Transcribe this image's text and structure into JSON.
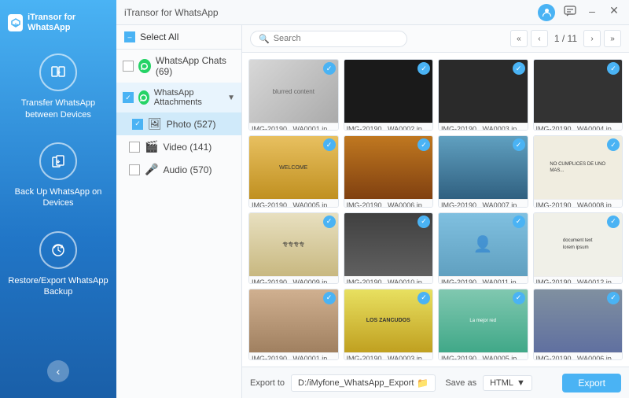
{
  "app": {
    "title": "iTransor for WhatsApp",
    "logo_letter": "i"
  },
  "titlebar": {
    "controls": [
      "chat-icon",
      "minimize-icon",
      "close-icon"
    ],
    "user_initial": "U"
  },
  "sidebar": {
    "items": [
      {
        "id": "transfer",
        "label": "Transfer WhatsApp\nbetween Devices",
        "icon": "transfer"
      },
      {
        "id": "backup",
        "label": "Back Up WhatsApp\non Devices",
        "icon": "backup"
      },
      {
        "id": "restore",
        "label": "Restore/Export\nWhatsApp Backup",
        "icon": "restore"
      }
    ]
  },
  "tree": {
    "select_all": "Select All",
    "items": [
      {
        "id": "chats",
        "label": "WhatsApp Chats (69)",
        "checked": false,
        "icon": "whatsapp"
      },
      {
        "id": "attachments",
        "label": "WhatsApp Attachments",
        "checked": true,
        "icon": "whatsapp",
        "expanded": true
      },
      {
        "id": "photo",
        "label": "Photo (527)",
        "checked": true,
        "type": "sub"
      },
      {
        "id": "video",
        "label": "Video (141)",
        "checked": false,
        "type": "sub2"
      },
      {
        "id": "audio",
        "label": "Audio (570)",
        "checked": false,
        "type": "sub2"
      }
    ]
  },
  "toolbar": {
    "search_placeholder": "Search",
    "page_current": "1",
    "page_total": "11",
    "page_label": "1 / 11"
  },
  "photos": [
    {
      "id": 1,
      "label": "IMG-20190...WA0001.jp",
      "checked": true,
      "bg": "gray"
    },
    {
      "id": 2,
      "label": "IMG-20190...WA0002.jp",
      "checked": true,
      "bg": "dark"
    },
    {
      "id": 3,
      "label": "IMG-20190...WA0003.jp",
      "checked": true,
      "bg": "dark2"
    },
    {
      "id": 4,
      "label": "IMG-20190...WA0004.jp",
      "checked": true,
      "bg": "dark3"
    },
    {
      "id": 5,
      "label": "IMG-20190...WA0005.jp",
      "checked": true,
      "bg": "brown"
    },
    {
      "id": 6,
      "label": "IMG-20190...WA0006.jp",
      "checked": true,
      "bg": "restaurant"
    },
    {
      "id": 7,
      "label": "IMG-20190...WA0007.jp",
      "checked": true,
      "bg": "outdoor"
    },
    {
      "id": 8,
      "label": "IMG-20190...WA0008.jp",
      "checked": true,
      "bg": "text-img"
    },
    {
      "id": 9,
      "label": "IMG-20190...WA0009.jp",
      "checked": true,
      "bg": "sign"
    },
    {
      "id": 10,
      "label": "IMG-20190...WA0010.jp",
      "checked": true,
      "bg": "interior"
    },
    {
      "id": 11,
      "label": "IMG-20190...WA0011.jp",
      "checked": true,
      "bg": "blue-person"
    },
    {
      "id": 12,
      "label": "IMG-20190...WA0012.jp",
      "checked": true,
      "bg": "document"
    },
    {
      "id": 13,
      "label": "IMG-20190...WA0001.jp",
      "checked": true,
      "bg": "people"
    },
    {
      "id": 14,
      "label": "IMG-20190...WA0003.jp",
      "checked": true,
      "bg": "poster"
    },
    {
      "id": 15,
      "label": "IMG-20190...WA0005.jp",
      "checked": true,
      "bg": "teal-person"
    },
    {
      "id": 16,
      "label": "IMG-20190...WA0006.jp",
      "checked": true,
      "bg": "landscape"
    }
  ],
  "bottom_bar": {
    "export_to_label": "Export to",
    "export_path": "D:/iMyfone_WhatsApp_Export",
    "save_as_label": "Save as",
    "save_as_value": "HTML",
    "export_btn": "Export"
  }
}
